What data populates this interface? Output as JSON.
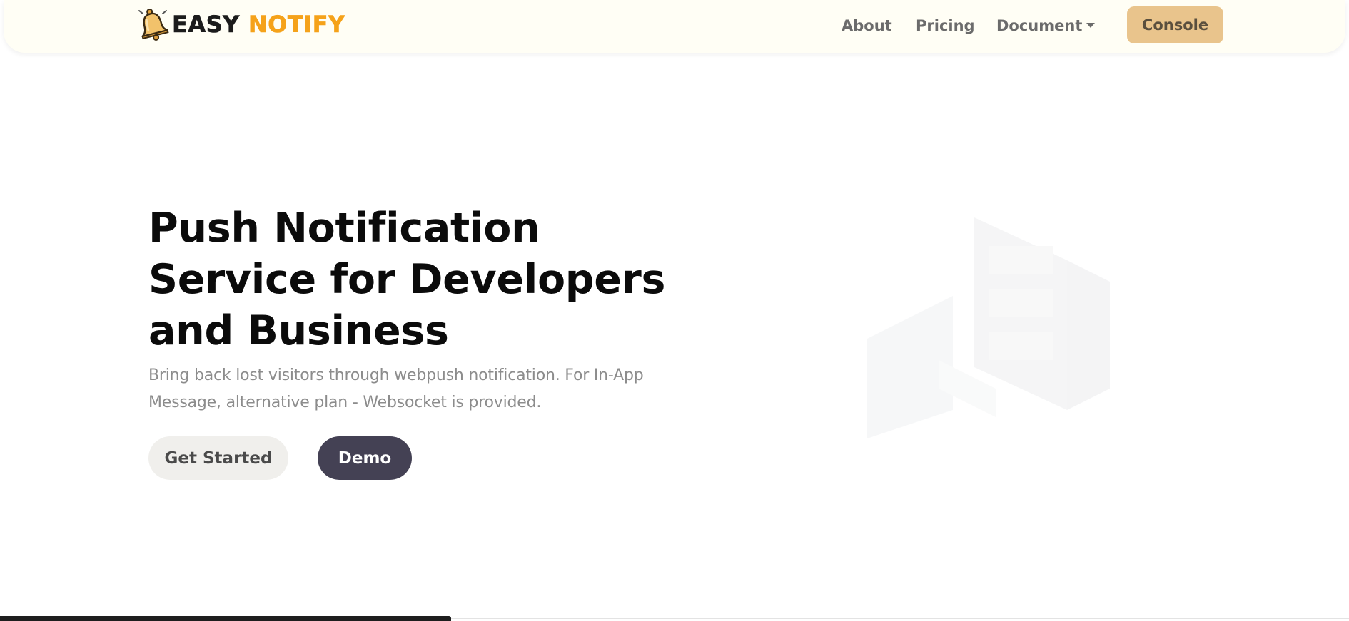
{
  "navbar": {
    "logo_icon": "bell-icon",
    "brand_part1": "EASY",
    "brand_part2": "NOTIFY",
    "about_label": "About",
    "pricing_label": "Pricing",
    "document_label": "Document",
    "document_icon": "caret-down-icon",
    "console_label": "Console"
  },
  "hero": {
    "title": "Push Notification Service for Developers and Business",
    "subtitle": "Bring back lost visitors through webpush notification. For In-App Message, alternative plan - Websocket is provided.",
    "get_started_label": "Get Started",
    "demo_label": "Demo"
  },
  "colors": {
    "navbar_bg": "#fffef5",
    "brand_accent": "#f5a21a",
    "console_bg": "#e9c48c",
    "demo_bg": "#444154",
    "get_started_bg": "#f0efec"
  }
}
